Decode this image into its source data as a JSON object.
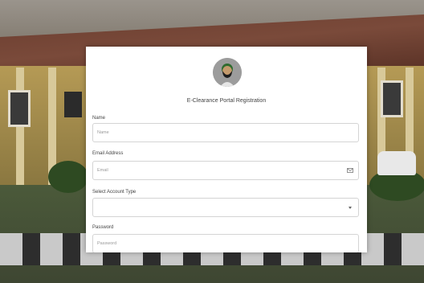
{
  "form": {
    "title": "E-Clearance Portal Registration",
    "name_label": "Name",
    "name_placeholder": "Name",
    "email_label": "Email Address",
    "email_placeholder": "Email",
    "account_type_label": "Select Account Type",
    "account_type_value": "",
    "password_label": "Password",
    "password_placeholder": "Password"
  },
  "icons": {
    "email": "envelope-icon",
    "select": "chevron-down-icon",
    "logo": "avatar-logo"
  },
  "colors": {
    "card_bg": "#ffffff",
    "field_border": "#d4d4d4",
    "label_text": "#444444",
    "placeholder_text": "#9a9a9a"
  }
}
